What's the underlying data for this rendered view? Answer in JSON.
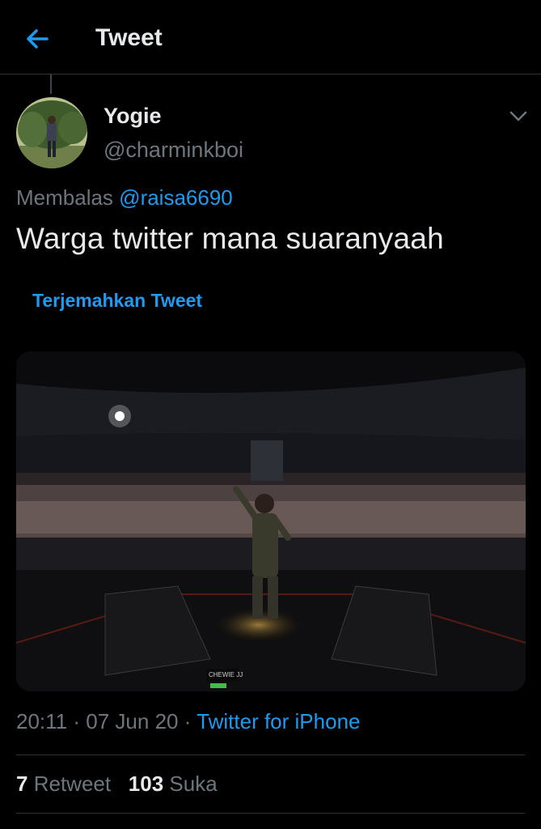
{
  "header": {
    "title": "Tweet",
    "back_icon": "arrow-left-icon",
    "accent": "#1d9bf0"
  },
  "author": {
    "name": "Yogie",
    "handle": "@charminkboi"
  },
  "reply": {
    "prefix": "Membalas",
    "mention": "@raisa6690"
  },
  "tweet": {
    "text": "Warga twitter mana suaranyaah",
    "translate_label": "Terjemahkan Tweet"
  },
  "media": {
    "description_icon": "concert-photo",
    "banner_text": "CHEWIE JJ"
  },
  "meta": {
    "time": "20:11",
    "sep1": "·",
    "date": "07 Jun 20",
    "sep2": "·",
    "client": "Twitter for iPhone"
  },
  "stats": {
    "retweets": "7",
    "retweet_label": "Retweet",
    "likes": "103",
    "likes_label": "Suka"
  }
}
